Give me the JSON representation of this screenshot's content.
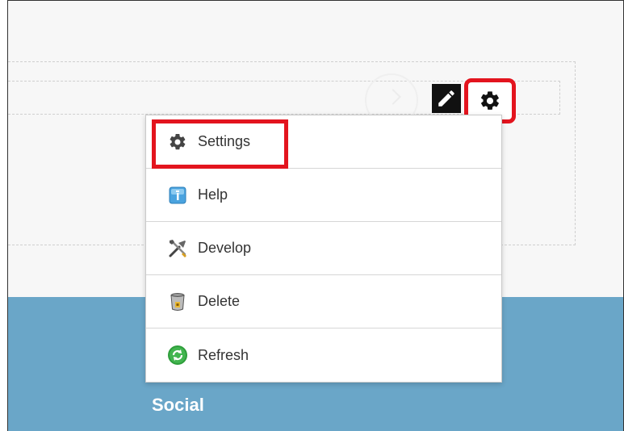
{
  "toolbar": {
    "edit_icon": "pencil-icon",
    "settings_icon": "gear-icon"
  },
  "menu": {
    "items": [
      {
        "label": "Settings",
        "icon": "gear-icon"
      },
      {
        "label": "Help",
        "icon": "help-icon"
      },
      {
        "label": "Develop",
        "icon": "tools-icon"
      },
      {
        "label": "Delete",
        "icon": "trash-icon"
      },
      {
        "label": "Refresh",
        "icon": "refresh-icon"
      }
    ]
  },
  "section": {
    "title": "Social"
  },
  "colors": {
    "highlight": "#e3141e",
    "band": "#6aa6c8"
  }
}
